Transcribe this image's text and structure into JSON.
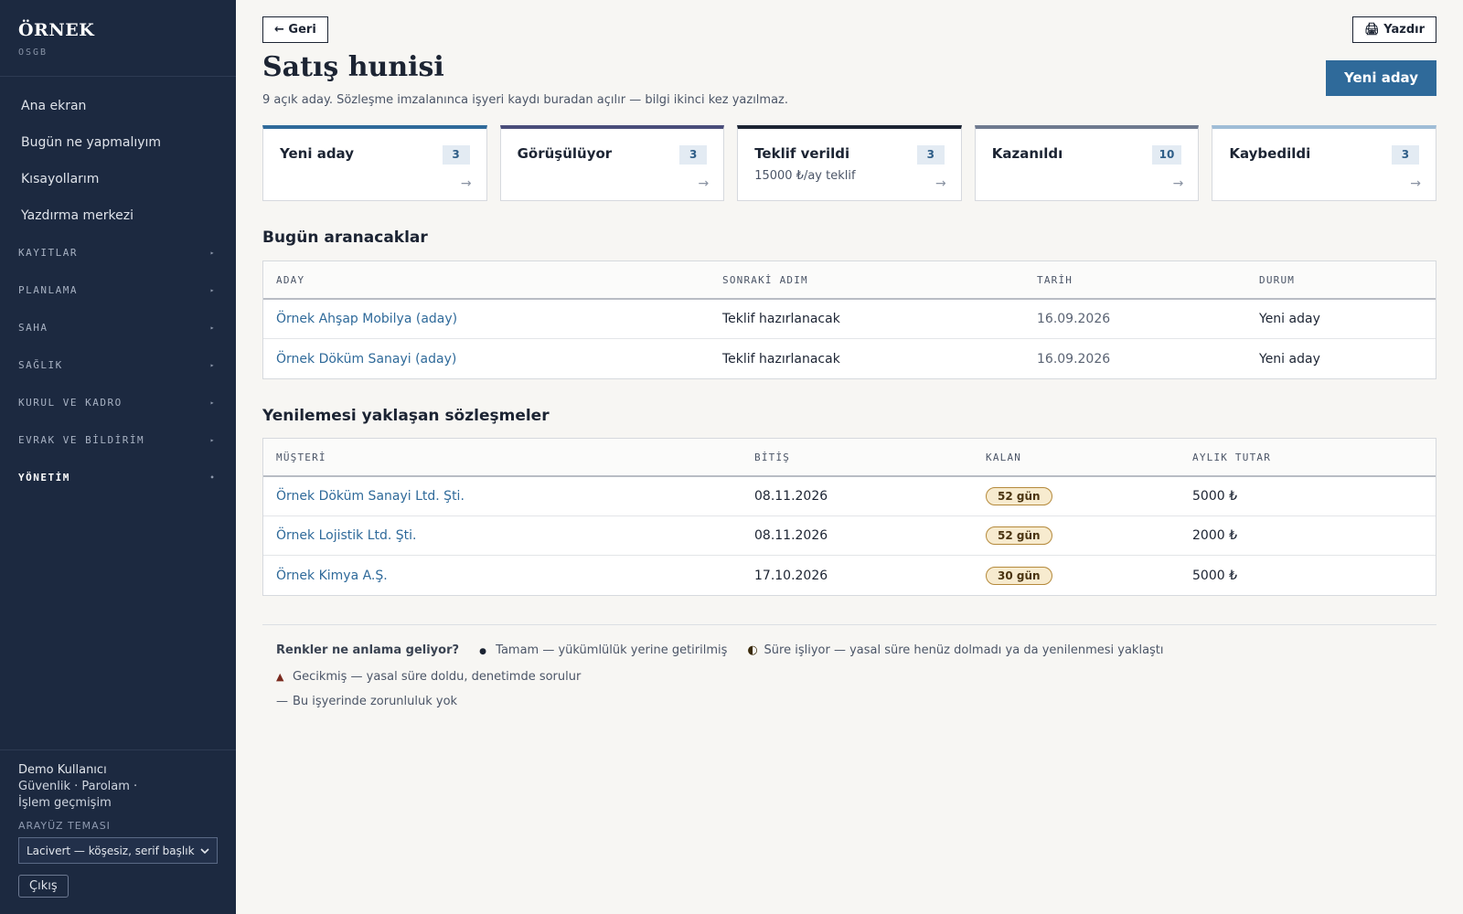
{
  "brand": {
    "name": "ÖRNEK",
    "sub": "OSGB"
  },
  "nav": {
    "items": [
      "Ana ekran",
      "Bugün ne yapmalıyım",
      "Kısayollarım",
      "Yazdırma merkezi"
    ],
    "groups": [
      "KAYITLAR",
      "PLANLAMA",
      "SAHA",
      "SAĞLIK",
      "KURUL VE KADRO",
      "EVRAK VE BİLDİRİM",
      "YÖNETİM"
    ],
    "arrow": "▸",
    "active_dot": "•"
  },
  "footer": {
    "user": "Demo Kullanıcı",
    "link_security": "Güvenlik",
    "link_password": "Parolam",
    "link_history": "İşlem geçmişim",
    "sep": "·",
    "theme_label": "ARAYÜZ TEMASI",
    "theme_value": "Lacivert — köşesiz, serif başlık",
    "logout": "Çıkış"
  },
  "header": {
    "back": "← Geri",
    "print": "🖨 Yazdır",
    "title": "Satış hunisi",
    "subtitle": "9 açık aday. Sözleşme imzalanınca işyeri kaydı buradan açılır — bilgi ikinci kez yazılmaz.",
    "primary": "Yeni aday"
  },
  "stages": [
    {
      "name": "Yeni aday",
      "count": "3",
      "note": "",
      "color": "#2f6a9a"
    },
    {
      "name": "Görüşülüyor",
      "count": "3",
      "note": "",
      "color": "#4a4d7a"
    },
    {
      "name": "Teklif verildi",
      "count": "3",
      "note": "15000 ₺/ay teklif",
      "color": "#1c2433"
    },
    {
      "name": "Kazanıldı",
      "count": "10",
      "note": "",
      "color": "#6f7a8f"
    },
    {
      "name": "Kaybedildi",
      "count": "3",
      "note": "",
      "color": "#9fbdd6"
    }
  ],
  "stage_arrow": "→",
  "calls": {
    "title": "Bugün aranacaklar",
    "headers": [
      "ADAY",
      "SONRAKİ ADIM",
      "TARİH",
      "DURUM"
    ],
    "rows": [
      [
        "Örnek Ahşap Mobilya (aday)",
        "Teklif hazırlanacak",
        "16.09.2026",
        "Yeni aday"
      ],
      [
        "Örnek Döküm Sanayi (aday)",
        "Teklif hazırlanacak",
        "16.09.2026",
        "Yeni aday"
      ]
    ]
  },
  "renewals": {
    "title": "Yenilemesi yaklaşan sözleşmeler",
    "headers": [
      "MÜŞTERİ",
      "BİTİŞ",
      "KALAN",
      "AYLIK TUTAR"
    ],
    "rows": [
      [
        "Örnek Döküm Sanayi Ltd. Şti.",
        "08.11.2026",
        "52 gün",
        "5000 ₺"
      ],
      [
        "Örnek Lojistik Ltd. Şti.",
        "08.11.2026",
        "52 gün",
        "2000 ₺"
      ],
      [
        "Örnek Kimya A.Ş.",
        "17.10.2026",
        "30 gün",
        "5000 ₺"
      ]
    ]
  },
  "legend": {
    "title": "Renkler ne anlama geliyor?",
    "items": [
      {
        "sym": "●",
        "text": "Tamam — yükümlülük yerine getirilmiş",
        "color": "#1c2433"
      },
      {
        "sym": "◐",
        "text": "Süre işliyor — yasal süre henüz dolmadı ya da yenilenmesi yaklaştı",
        "color": "#1c2433"
      },
      {
        "sym": "▲",
        "text": "Gecikmiş — yasal süre doldu, denetimde sorulur",
        "color": "#7a2a1e"
      },
      {
        "sym": "—",
        "text": "Bu işyerinde zorunluluk yok",
        "color": "#4b5567"
      }
    ]
  }
}
